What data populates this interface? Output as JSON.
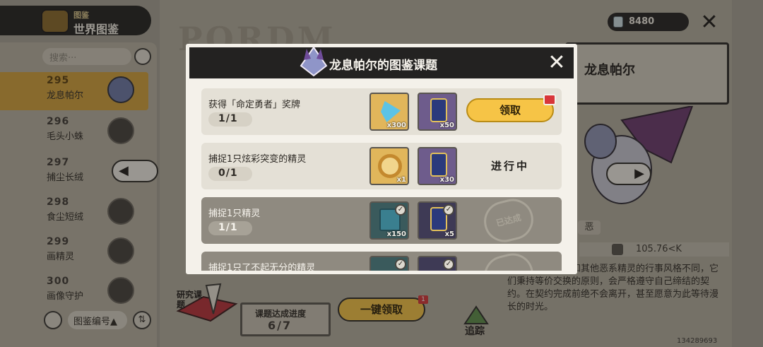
{
  "header": {
    "category_small": "图鉴",
    "title": "世界图鉴",
    "coins": "8480",
    "search_placeholder": "搜索···"
  },
  "watermark": "PORDM",
  "list": [
    {
      "number": "295",
      "name": "龙息帕尔",
      "selected": true
    },
    {
      "number": "296",
      "name": "毛头小蛛",
      "selected": false
    },
    {
      "number": "297",
      "name": "捕尘长绒",
      "selected": false
    },
    {
      "number": "298",
      "name": "食尘短绒",
      "selected": false
    },
    {
      "number": "299",
      "name": "画精灵",
      "selected": false
    },
    {
      "number": "300",
      "name": "画像守护",
      "selected": false
    }
  ],
  "sort": {
    "label": "图鉴编号▲",
    "order_icon": "⇅"
  },
  "detail": {
    "name": "龙息帕尔",
    "type": "恶",
    "weight": "105.76<K",
    "lore": "已载，龙息帕尔和其他恶系精灵的行事风格不同，它们秉持等价交换的原则，会严格遵守自己缔结的契约。在契约完成前绝不会离开，甚至愿意为此等待漫长的时光。"
  },
  "bottom": {
    "research_label": "研究课题",
    "progress_label": "课题达成进度",
    "progress_value": "6/7",
    "claim_all": "一键领取",
    "claim_all_badge": "1",
    "track": "追踪",
    "uid": "134289693"
  },
  "modal": {
    "title": "龙息帕尔的图鉴课题",
    "close_icon": "close-icon",
    "tasks": [
      {
        "name": "获得「命定勇者」奖牌",
        "progress": "1/1",
        "rewards": [
          {
            "icon": "crystal-icon",
            "qty": "x300"
          },
          {
            "icon": "ticket-icon",
            "qty": "x50"
          }
        ],
        "action": "领取",
        "state": "claimable"
      },
      {
        "name": "捕捉1只炫彩突变的精灵",
        "progress": "0/1",
        "rewards": [
          {
            "icon": "ring-icon",
            "qty": "x1"
          },
          {
            "icon": "ticket-icon",
            "qty": "x30"
          }
        ],
        "action": "进行中",
        "state": "in-progress"
      },
      {
        "name": "捕捉1只精灵",
        "progress": "1/1",
        "rewards": [
          {
            "icon": "card-icon",
            "qty": "x150"
          },
          {
            "icon": "ticket-icon",
            "qty": "x5"
          }
        ],
        "action": "已达成",
        "state": "done"
      },
      {
        "name": "捕捉1只了不起无分的精灵",
        "progress": "",
        "rewards": [
          {
            "icon": "card-icon",
            "qty": ""
          },
          {
            "icon": "ticket-icon",
            "qty": ""
          }
        ],
        "action": "",
        "state": "done"
      }
    ]
  }
}
